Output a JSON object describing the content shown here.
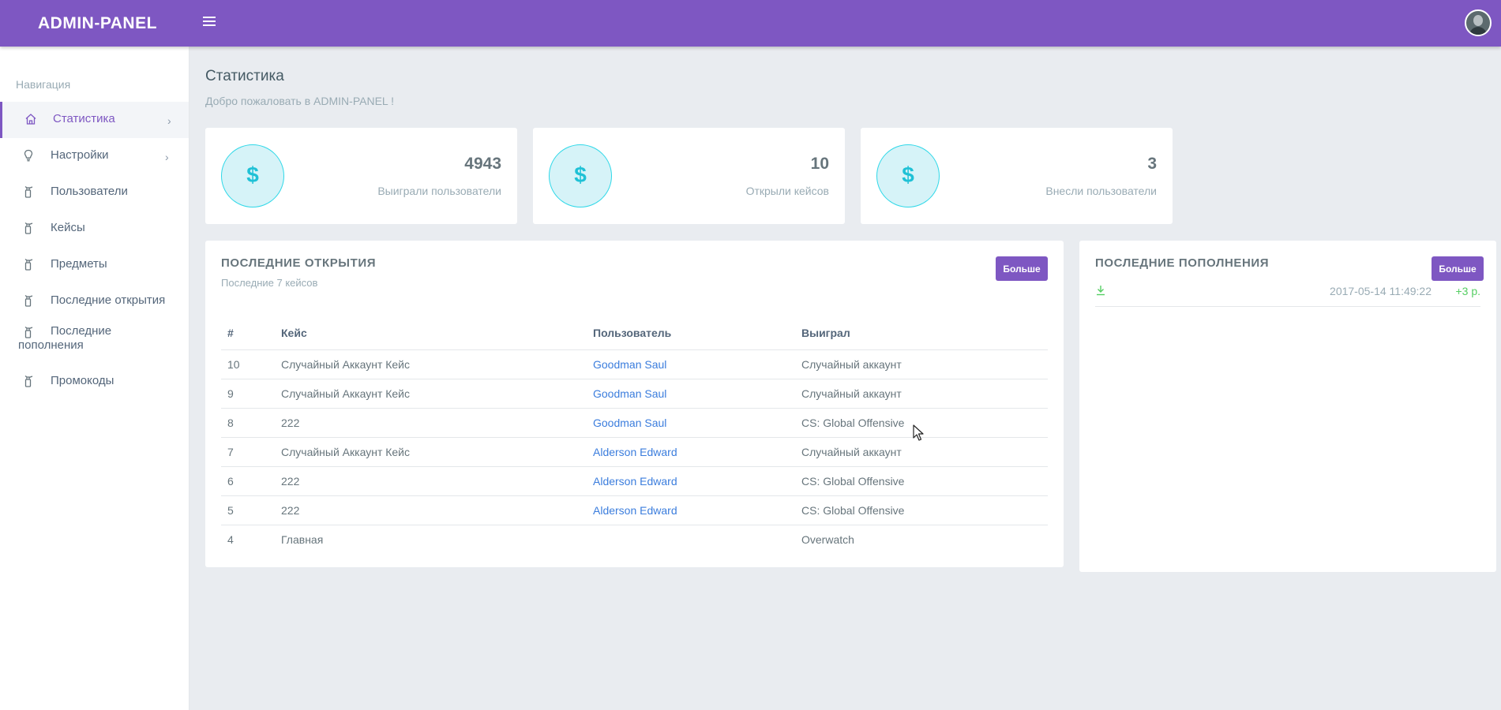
{
  "topbar": {
    "brand": "ADMIN-PANEL",
    "menu_icon": "hamburger-icon",
    "avatar": "user-avatar"
  },
  "sidebar": {
    "title": "Навигация",
    "items": [
      {
        "label": "Статистика",
        "icon": "home-icon",
        "active": true,
        "arrow": "›"
      },
      {
        "label": "Настройки",
        "icon": "bulb-icon",
        "active": false,
        "arrow": "›"
      },
      {
        "label": "Пользователи",
        "icon": "extinguisher-icon",
        "active": false
      },
      {
        "label": "Кейсы",
        "icon": "extinguisher-icon",
        "active": false
      },
      {
        "label": "Предметы",
        "icon": "extinguisher-icon",
        "active": false
      },
      {
        "label": "Последние открытия",
        "icon": "extinguisher-icon",
        "active": false
      },
      {
        "label": "Последние",
        "label2": "пополнения",
        "icon": "extinguisher-icon",
        "active": false
      },
      {
        "label": "Промокоды",
        "icon": "extinguisher-icon",
        "active": false
      }
    ]
  },
  "page": {
    "title": "Статистика",
    "subtitle": "Добро пожаловать в ADMIN-PANEL !"
  },
  "stats": [
    {
      "icon": "$",
      "value": "4943",
      "label": "Выиграли пользователи"
    },
    {
      "icon": "$",
      "value": "10",
      "label": "Открыли кейсов"
    },
    {
      "icon": "$",
      "value": "3",
      "label": "Внесли пользователи"
    }
  ],
  "latest_opens": {
    "title": "ПОСЛЕДНИЕ ОТКРЫТИЯ",
    "subtitle": "Последние 7 кейсов",
    "more_label": "Больше",
    "columns": [
      "#",
      "Кейс",
      "Пользователь",
      "Выиграл"
    ],
    "rows": [
      [
        "10",
        "Случайный Аккаунт Кейс",
        "Goodman Saul",
        "Случайный аккаунт"
      ],
      [
        "9",
        "Случайный Аккаунт Кейс",
        "Goodman Saul",
        "Случайный аккаунт"
      ],
      [
        "8",
        "222",
        "Goodman Saul",
        "CS: Global Offensive"
      ],
      [
        "7",
        "Случайный Аккаунт Кейс",
        "Alderson Edward",
        "Случайный аккаунт"
      ],
      [
        "6",
        "222",
        "Alderson Edward",
        "CS: Global Offensive"
      ],
      [
        "5",
        "222",
        "Alderson Edward",
        "CS: Global Offensive"
      ],
      [
        "4",
        "Главная",
        "",
        "Overwatch"
      ]
    ]
  },
  "latest_deposits": {
    "title": "ПОСЛЕДНИЕ ПОПОЛНЕНИЯ",
    "more_label": "Больше",
    "rows": [
      {
        "icon": "download-icon",
        "date": "2017-05-14 11:49:22",
        "amount": "+3 р."
      }
    ]
  },
  "colors": {
    "accent": "#7e57c2",
    "info": "#1fc1d6",
    "success": "#55ce63",
    "link": "#3b7ddd"
  }
}
